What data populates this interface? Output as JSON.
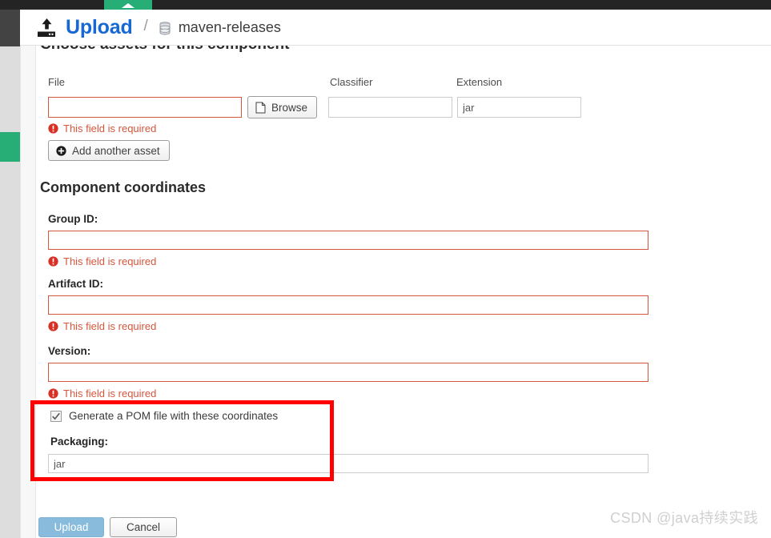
{
  "browser": {
    "tab_caret": "caret-up-icon"
  },
  "sidebar": {
    "accent_color": "#27ae76",
    "rail_color": "#dddddd",
    "header_block_color": "#434343"
  },
  "header": {
    "upload_icon": "upload-icon",
    "title": "Upload",
    "separator": "/",
    "repo_icon": "database-icon",
    "repo_name": "maven-releases",
    "title_color": "#1669d4"
  },
  "assets_section": {
    "title": "Choose assets for this component",
    "columns": {
      "file": "File",
      "classifier": "Classifier",
      "extension": "Extension"
    },
    "file_value": "",
    "file_placeholder": "",
    "classifier_value": "",
    "classifier_placeholder": "",
    "extension_value": "jar",
    "extension_placeholder": "jar",
    "browse_label": "Browse",
    "browse_icon": "file-page-icon",
    "file_error": "This field is required",
    "add_asset_label": "Add another asset",
    "add_asset_icon": "plus-circle-icon"
  },
  "coordinates_section": {
    "title": "Component coordinates",
    "fields": [
      {
        "label": "Group ID:",
        "value": "",
        "placeholder": "",
        "error": "This field is required"
      },
      {
        "label": "Artifact ID:",
        "value": "",
        "placeholder": "",
        "error": "This field is required"
      },
      {
        "label": "Version:",
        "value": "",
        "placeholder": "",
        "error": "This field is required"
      }
    ],
    "generate_pom_label": "Generate a POM file with these coordinates",
    "generate_pom_checked": true,
    "packaging_label": "Packaging:",
    "packaging_value": "jar",
    "packaging_placeholder": "jar"
  },
  "annotation": {
    "color": "#ff0000"
  },
  "footer": {
    "upload_label": "Upload",
    "cancel_label": "Cancel"
  },
  "watermark": {
    "text": "CSDN @java持续实践"
  }
}
